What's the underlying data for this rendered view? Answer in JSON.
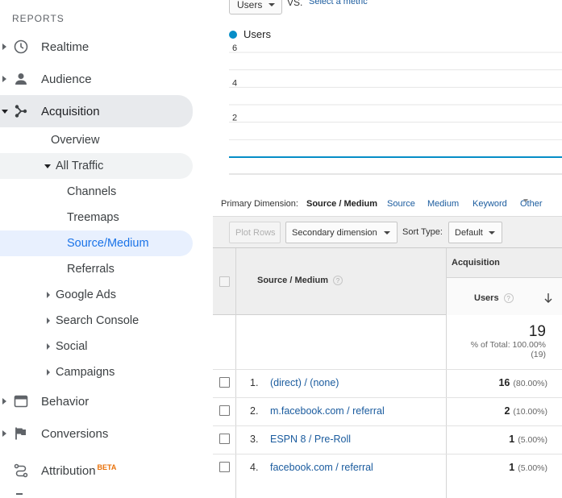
{
  "sidebar": {
    "section_label": "REPORTS",
    "items": [
      {
        "label": "Realtime",
        "icon": "clock-icon"
      },
      {
        "label": "Audience",
        "icon": "person-icon"
      },
      {
        "label": "Acquisition",
        "icon": "acquisition-icon"
      },
      {
        "label": "Behavior",
        "icon": "behavior-icon"
      },
      {
        "label": "Conversions",
        "icon": "flag-icon"
      },
      {
        "label": "Attribution",
        "badge": "BETA",
        "icon": "attribution-icon"
      }
    ],
    "acquisition_sub": {
      "overview": "Overview",
      "all_traffic": "All Traffic",
      "all_traffic_children": [
        "Channels",
        "Treemaps",
        "Source/Medium",
        "Referrals"
      ],
      "others": [
        "Google Ads",
        "Search Console",
        "Social",
        "Campaigns"
      ]
    }
  },
  "chart_controls": {
    "metric_select": "Users",
    "vs_label": "VS.",
    "select_metric_link": "Select a metric"
  },
  "chart_data": {
    "type": "line",
    "title": "",
    "series": [
      {
        "name": "Users",
        "color": "#058dc7",
        "values": [
          0,
          0
        ]
      }
    ],
    "yticks": [
      "6",
      "4",
      "2"
    ],
    "ylim": [
      0,
      6
    ],
    "grid": true,
    "legend": "top-left"
  },
  "primary_dimension": {
    "label": "Primary Dimension:",
    "current": "Source / Medium",
    "links": [
      "Source",
      "Medium",
      "Keyword",
      "Other"
    ]
  },
  "toolbar": {
    "plot_rows": "Plot Rows",
    "secondary_dimension": "Secondary dimension",
    "sort_type_label": "Sort Type:",
    "sort_type_value": "Default"
  },
  "table": {
    "group_header": "Acquisition",
    "dimension_header": "Source / Medium",
    "metric_header": "Users",
    "help_glyph": "?",
    "total": {
      "value": "19",
      "pct_line": "% of Total: 100.00%",
      "abs_line": "(19)"
    },
    "rows": [
      {
        "num": "1.",
        "source": "(direct) / (none)",
        "users": "16",
        "pct": "(80.00%)"
      },
      {
        "num": "2.",
        "source": "m.facebook.com / referral",
        "users": "2",
        "pct": "(10.00%)"
      },
      {
        "num": "3.",
        "source": "ESPN 8 / Pre-Roll",
        "users": "1",
        "pct": "(5.00%)"
      },
      {
        "num": "4.",
        "source": "facebook.com / referral",
        "users": "1",
        "pct": "(5.00%)"
      }
    ]
  }
}
